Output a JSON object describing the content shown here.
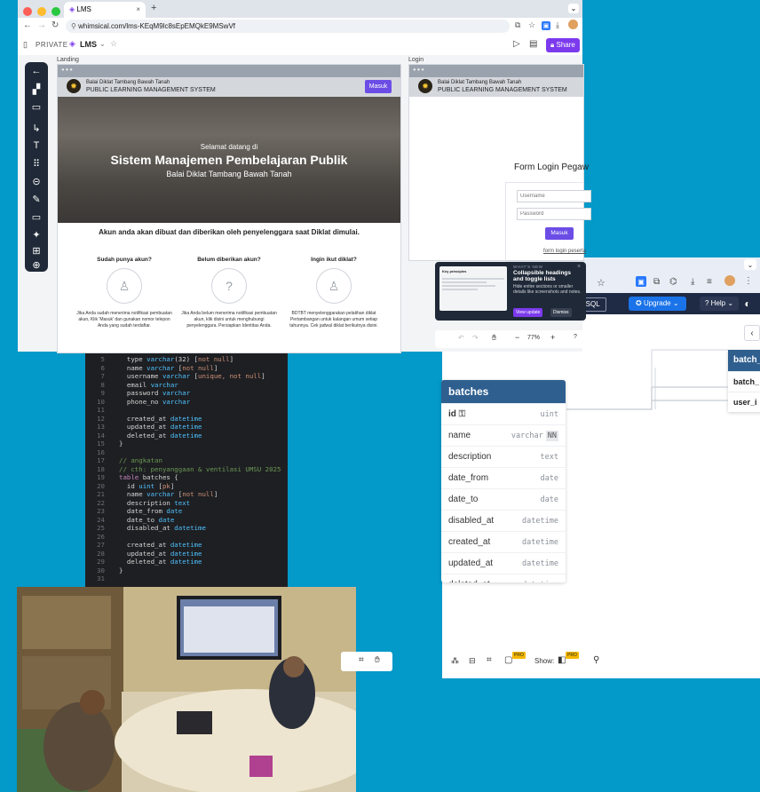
{
  "whimsical": {
    "tab_title": "LMS",
    "url": "whimsical.com/lms-KEqM9lc8sEpEMQkE9MSwVf",
    "private_label": "PRIVATE",
    "doc_name": "LMS",
    "share_label": "Share",
    "landing_label": "Landing",
    "login_label": "Login",
    "org_name": "Balai Diklat Tambang Bawah Tanah",
    "system_name": "PUBLIC LEARNING MANAGEMENT SYSTEM",
    "masuk_label": "Masuk",
    "hero_welcome": "Selamat datang di",
    "hero_title": "Sistem Manajemen Pembelajaran Publik",
    "hero_subtitle": "Balai Diklat Tambang Bawah Tanah",
    "account_notice": "Akun anda akan dibuat dan diberikan oleh penyelenggara saat Diklat dimulai.",
    "cards": [
      {
        "title": "Sudah punya akun?",
        "text": "Jika Anda sudah menerima notifikasi pembuatan akun, Klik 'Masuk' dan gunakan nomor telepon Anda yang sudah terdaftar."
      },
      {
        "title": "Belum diberikan akun?",
        "text": "Jika Anda belum menerima notifikasi pembuatan akun, klik disini untuk menghubungi penyelenggara. Persiapkan Identitas Anda."
      },
      {
        "title": "Ingin ikut diklat?",
        "text": "BDTBT menyelenggarakan pelatihan diklat Pertambangan untuk kalangan umum setiap tahunnya. Cek jadwal diklat berikutnya disini."
      }
    ],
    "login": {
      "form_title": "Form Login Pegaw",
      "username_placeholder": "Username",
      "password_placeholder": "Password",
      "masuk_label": "Masuk",
      "link": "form login peserta"
    },
    "toast": {
      "kicker": "WHAT'S NEW",
      "title": "Collapsible headings and toggle lists",
      "body": "Hide entire sections or smaller details like screenshots and notes.",
      "view_label": "View update",
      "dismiss_label": "Dismiss",
      "preview_title": "Key principles"
    },
    "zoom": "77%",
    "help": "?"
  },
  "dbdiagram": {
    "runsql": "RunSQL",
    "upgrade": "Upgrade",
    "help": "Help",
    "right_table_title": "batch_",
    "right_rows": [
      "batch_",
      "user_i"
    ],
    "show_label": "Show:",
    "pro_badge": "PRO"
  },
  "table": {
    "title": "batches",
    "rows": [
      {
        "name": "id",
        "type": "uint"
      },
      {
        "name": "name",
        "type": "varchar",
        "badge": "NN"
      },
      {
        "name": "description",
        "type": "text"
      },
      {
        "name": "date_from",
        "type": "date"
      },
      {
        "name": "date_to",
        "type": "date"
      },
      {
        "name": "disabled_at",
        "type": "datetime"
      },
      {
        "name": "created_at",
        "type": "datetime"
      },
      {
        "name": "updated_at",
        "type": "datetime"
      },
      {
        "name": "deleted_at",
        "type": "datetime"
      }
    ]
  },
  "code": [
    {
      "n": "5",
      "t": "  type varchar(32) [not null]"
    },
    {
      "n": "6",
      "t": "  name varchar [not null]"
    },
    {
      "n": "7",
      "t": "  username varchar [unique, not null]"
    },
    {
      "n": "8",
      "t": "  email varchar"
    },
    {
      "n": "9",
      "t": "  password varchar"
    },
    {
      "n": "10",
      "t": "  phone_no varchar"
    },
    {
      "n": "11",
      "t": ""
    },
    {
      "n": "12",
      "t": "  created_at datetime"
    },
    {
      "n": "13",
      "t": "  updated_at datetime"
    },
    {
      "n": "14",
      "t": "  deleted_at datetime"
    },
    {
      "n": "15",
      "t": "}"
    },
    {
      "n": "16",
      "t": ""
    },
    {
      "n": "17",
      "t": "// angkatan"
    },
    {
      "n": "18",
      "t": "// cth: penyanggaan & ventilasi UMSU 2025"
    },
    {
      "n": "19",
      "t": "table batches {"
    },
    {
      "n": "20",
      "t": "  id uint [pk]"
    },
    {
      "n": "21",
      "t": "  name varchar [not null]"
    },
    {
      "n": "22",
      "t": "  description text"
    },
    {
      "n": "23",
      "t": "  date_from date"
    },
    {
      "n": "24",
      "t": "  date_to date"
    },
    {
      "n": "25",
      "t": "  disabled_at datetime"
    },
    {
      "n": "26",
      "t": ""
    },
    {
      "n": "27",
      "t": "  created_at datetime"
    },
    {
      "n": "28",
      "t": "  updated_at datetime"
    },
    {
      "n": "29",
      "t": "  deleted_at datetime"
    },
    {
      "n": "30",
      "t": "}"
    },
    {
      "n": "31",
      "t": ""
    }
  ],
  "colors": {
    "background": "#0399c9",
    "accent_purple": "#6b4de6",
    "table_header": "#2f5f8f",
    "editor_bg": "#1e1f22",
    "db_toolbar": "#1f2a44",
    "upgrade_blue": "#1a73e8"
  }
}
